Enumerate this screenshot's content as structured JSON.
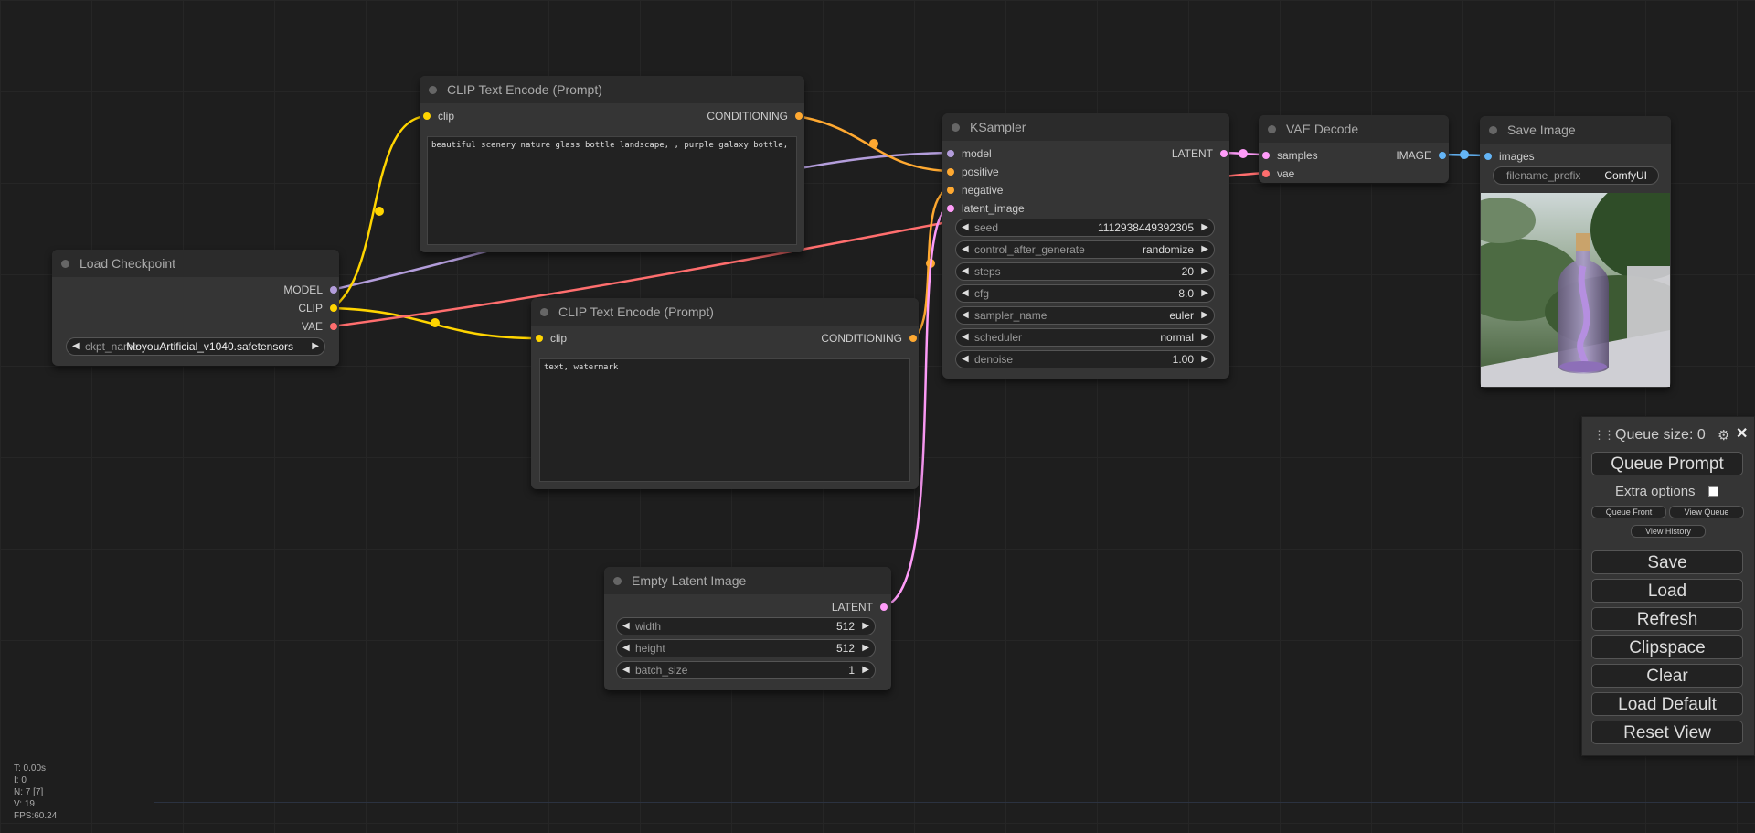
{
  "nodes": {
    "load_checkpoint": {
      "title": "Load Checkpoint",
      "outputs": [
        "MODEL",
        "CLIP",
        "VAE"
      ],
      "ckpt_label": "ckpt_name",
      "ckpt_value": "MoyouArtificial_v1040.safetensors"
    },
    "clip_pos": {
      "title": "CLIP Text Encode (Prompt)",
      "input": "clip",
      "output": "CONDITIONING",
      "text": "beautiful scenery nature glass bottle landscape, , purple galaxy bottle,"
    },
    "clip_neg": {
      "title": "CLIP Text Encode (Prompt)",
      "input": "clip",
      "output": "CONDITIONING",
      "text": "text, watermark"
    },
    "ksampler": {
      "title": "KSampler",
      "inputs": [
        "model",
        "positive",
        "negative",
        "latent_image"
      ],
      "output": "LATENT",
      "widgets": [
        {
          "label": "seed",
          "value": "1112938449392305"
        },
        {
          "label": "control_after_generate",
          "value": "randomize"
        },
        {
          "label": "steps",
          "value": "20"
        },
        {
          "label": "cfg",
          "value": "8.0"
        },
        {
          "label": "sampler_name",
          "value": "euler"
        },
        {
          "label": "scheduler",
          "value": "normal"
        },
        {
          "label": "denoise",
          "value": "1.00"
        }
      ]
    },
    "vae_decode": {
      "title": "VAE Decode",
      "inputs": [
        "samples",
        "vae"
      ],
      "output": "IMAGE"
    },
    "save_image": {
      "title": "Save Image",
      "input": "images",
      "prefix_label": "filename_prefix",
      "prefix_value": "ComfyUI"
    },
    "empty_latent": {
      "title": "Empty Latent Image",
      "output": "LATENT",
      "widgets": [
        {
          "label": "width",
          "value": "512"
        },
        {
          "label": "height",
          "value": "512"
        },
        {
          "label": "batch_size",
          "value": "1"
        }
      ]
    }
  },
  "queue_panel": {
    "queue_size": "Queue size: 0",
    "queue_prompt": "Queue Prompt",
    "extra_options": "Extra options",
    "queue_front": "Queue Front",
    "view_queue": "View Queue",
    "view_history": "View History",
    "buttons": [
      "Save",
      "Load",
      "Refresh",
      "Clipspace",
      "Clear",
      "Load Default",
      "Reset View"
    ]
  },
  "stats": [
    "T: 0.00s",
    "I: 0",
    "N: 7 [7]",
    "V: 19",
    "FPS:60.24"
  ],
  "colors": {
    "model": "#b39ddb",
    "clip": "#ffd500",
    "vae": "#ff6e6e",
    "conditioning": "#ffa931",
    "latent": "#ff9cf9",
    "image": "#64b5f6"
  }
}
